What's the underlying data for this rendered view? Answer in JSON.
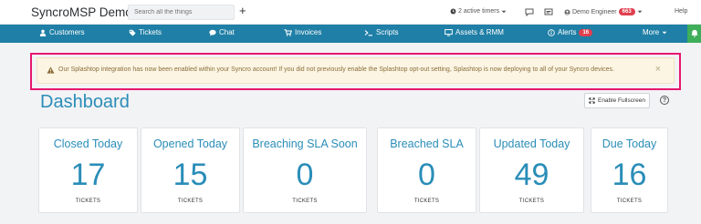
{
  "app": {
    "title": "SyncroMSP Demo"
  },
  "topbar": {
    "search_placeholder": "Search all the things",
    "new_label": "+",
    "timers_label": "2 active timers",
    "user_name": "Demo Engineer",
    "user_badge": "663",
    "help_label": "Help"
  },
  "nav": {
    "items": [
      {
        "label": "Customers",
        "icon": "user-icon"
      },
      {
        "label": "Tickets",
        "icon": "tag-icon"
      },
      {
        "label": "Chat",
        "icon": "chat-icon"
      },
      {
        "label": "Invoices",
        "icon": "cart-icon"
      },
      {
        "label": "Scripts",
        "icon": "terminal-icon"
      },
      {
        "label": "Assets & RMM",
        "icon": "monitor-icon"
      },
      {
        "label": "Alerts",
        "icon": "info-circle-icon",
        "badge": "16"
      },
      {
        "label": "More",
        "icon": "caret-down-icon"
      }
    ]
  },
  "alert": {
    "text": "Our Splashtop integration has now been enabled within your Syncro account! If you did not previously enable the Splashtop opt-out setting, Splashtop is now deploying to all of your Syncro devices.",
    "close": "×"
  },
  "dashboard": {
    "title": "Dashboard",
    "fullscreen_label": "Enable Fullscreen",
    "help": "?",
    "cards": [
      {
        "title": "Closed Today",
        "value": "17",
        "unit": "TICKETS"
      },
      {
        "title": "Opened Today",
        "value": "15",
        "unit": "TICKETS"
      },
      {
        "title": "Breaching SLA Soon",
        "value": "0",
        "unit": "TICKETS"
      },
      {
        "title": "Breached SLA",
        "value": "0",
        "unit": "TICKETS"
      },
      {
        "title": "Updated Today",
        "value": "49",
        "unit": "TICKETS"
      },
      {
        "title": "Due Today",
        "value": "16",
        "unit": "TICKETS"
      }
    ]
  },
  "colors": {
    "nav": "#1f7fa6",
    "accent": "#2a8db8",
    "alert_bg": "#fcf5e3",
    "highlight": "#e8176e",
    "badge": "#e0404f",
    "bell": "#3fae5a"
  }
}
